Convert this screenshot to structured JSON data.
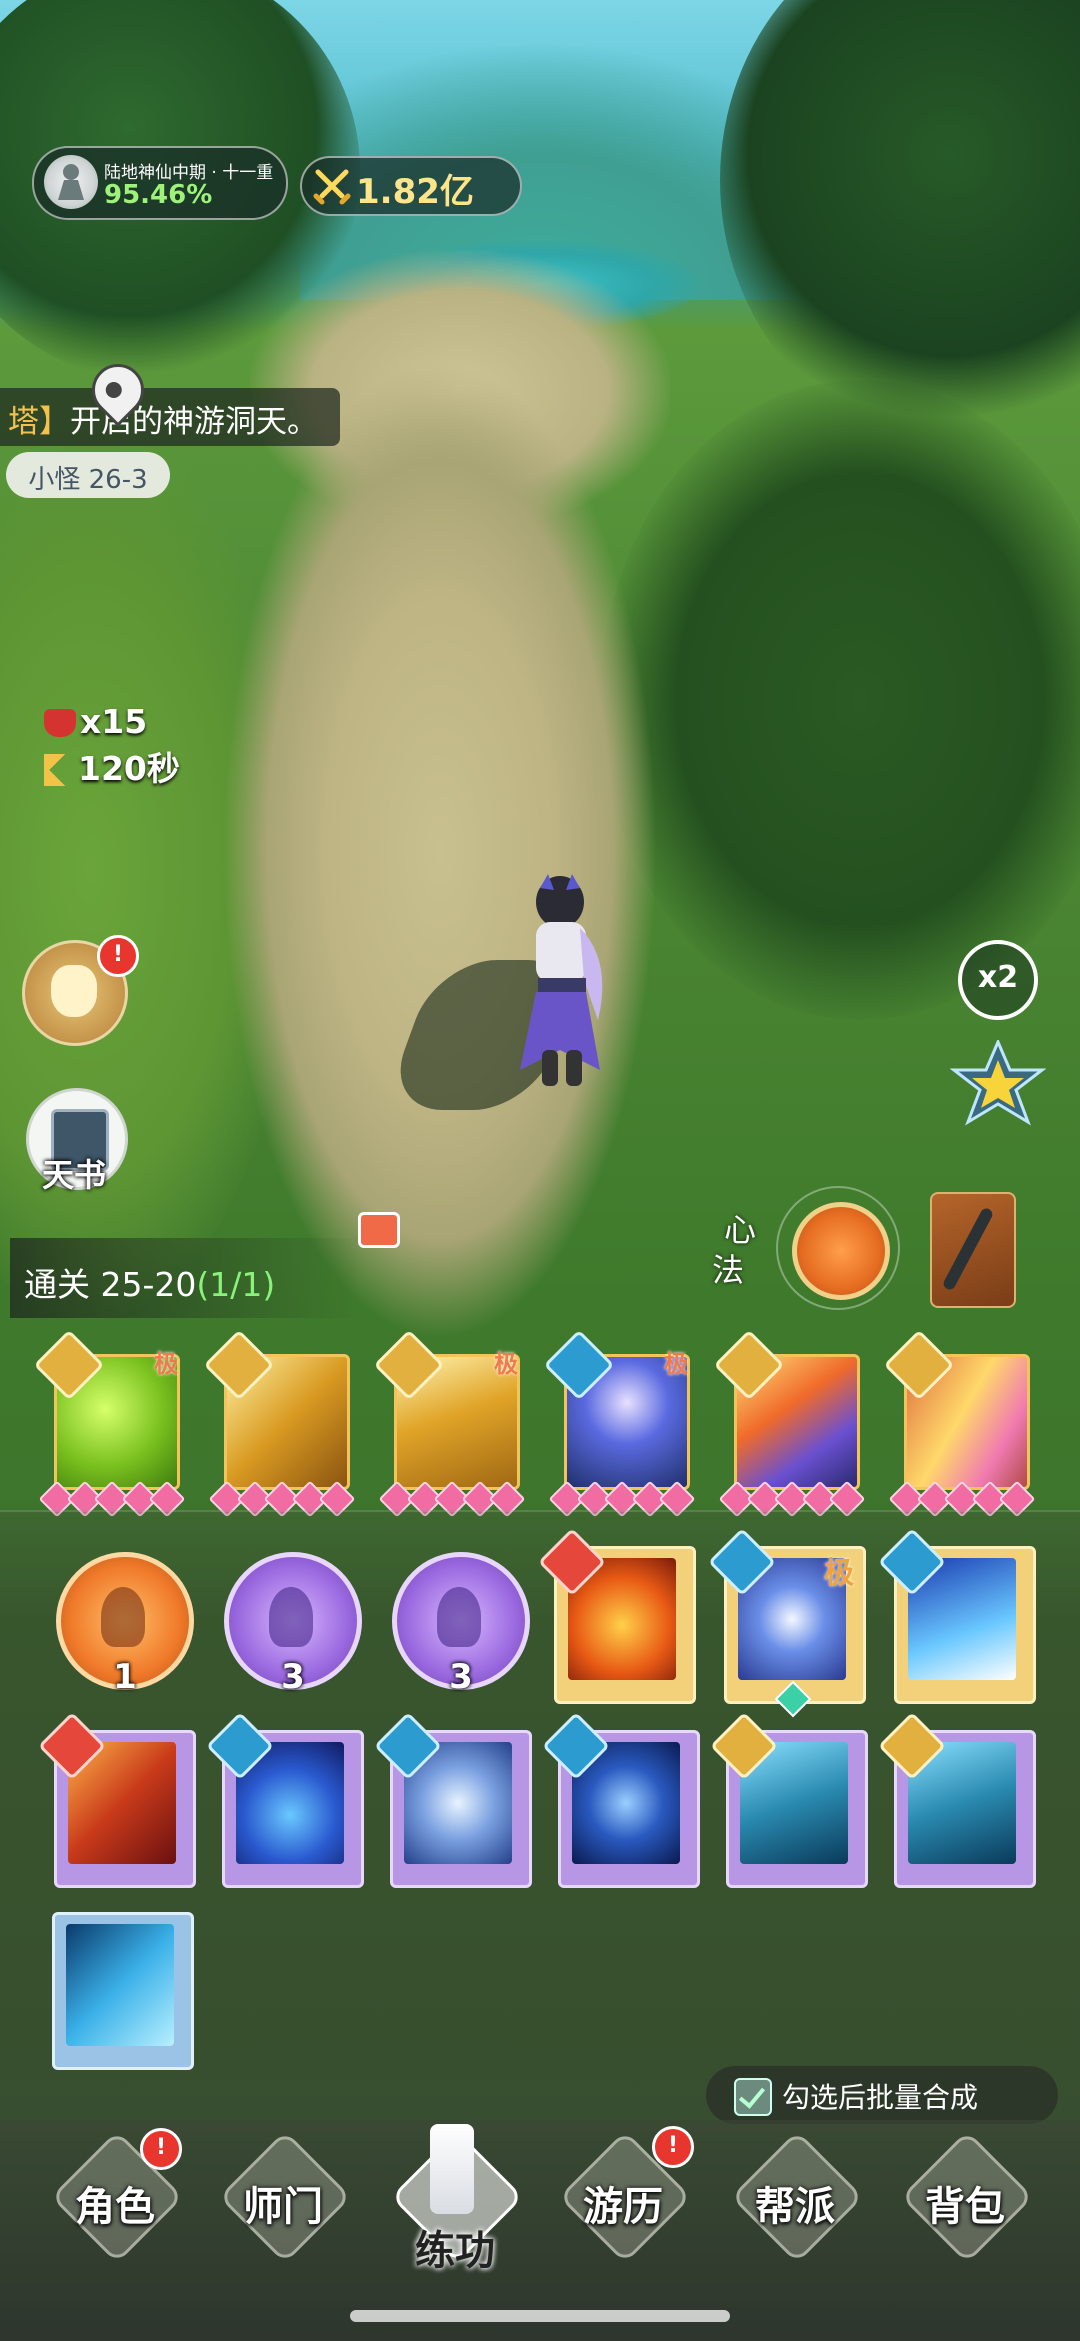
{
  "hud": {
    "realm_name": "陆地神仙中期 · 十一重",
    "realm_progress": "95.46%",
    "combat_power": "1.82亿"
  },
  "banner": {
    "bracket": "塔】",
    "text": "开启的神游洞天。"
  },
  "stage": {
    "tag": "小怪 26-3"
  },
  "wave": {
    "kills": "x15",
    "timer": "120秒"
  },
  "left_buttons": {
    "book_label": "天书",
    "bag_badge": "!"
  },
  "right_buttons": {
    "speed": "x2",
    "xinfa_label_1": "心",
    "xinfa_label_2": "法"
  },
  "progress": {
    "prefix": "通关 25-20",
    "highlight": "(1/1)"
  },
  "equipped_skills": [
    {
      "type": "sword",
      "ji": "极",
      "color": "green"
    },
    {
      "type": "sword",
      "ji": "",
      "color": "gold"
    },
    {
      "type": "sword",
      "ji": "极",
      "color": "gold"
    },
    {
      "type": "water",
      "ji": "极",
      "color": "blue"
    },
    {
      "type": "sword",
      "ji": "",
      "color": "fire"
    },
    {
      "type": "sword",
      "ji": "",
      "color": "pink"
    }
  ],
  "inventory": {
    "orbs": [
      {
        "color": "orange",
        "count": "1"
      },
      {
        "color": "purple",
        "count": "3"
      },
      {
        "color": "purple",
        "count": "3"
      }
    ],
    "ji_label": "极"
  },
  "batch": {
    "label": "勾选后批量合成",
    "checked": true
  },
  "nav": {
    "tabs": [
      "角色",
      "师门",
      "练功",
      "游历",
      "帮派",
      "背包"
    ],
    "active": "练功",
    "badge": "!"
  }
}
